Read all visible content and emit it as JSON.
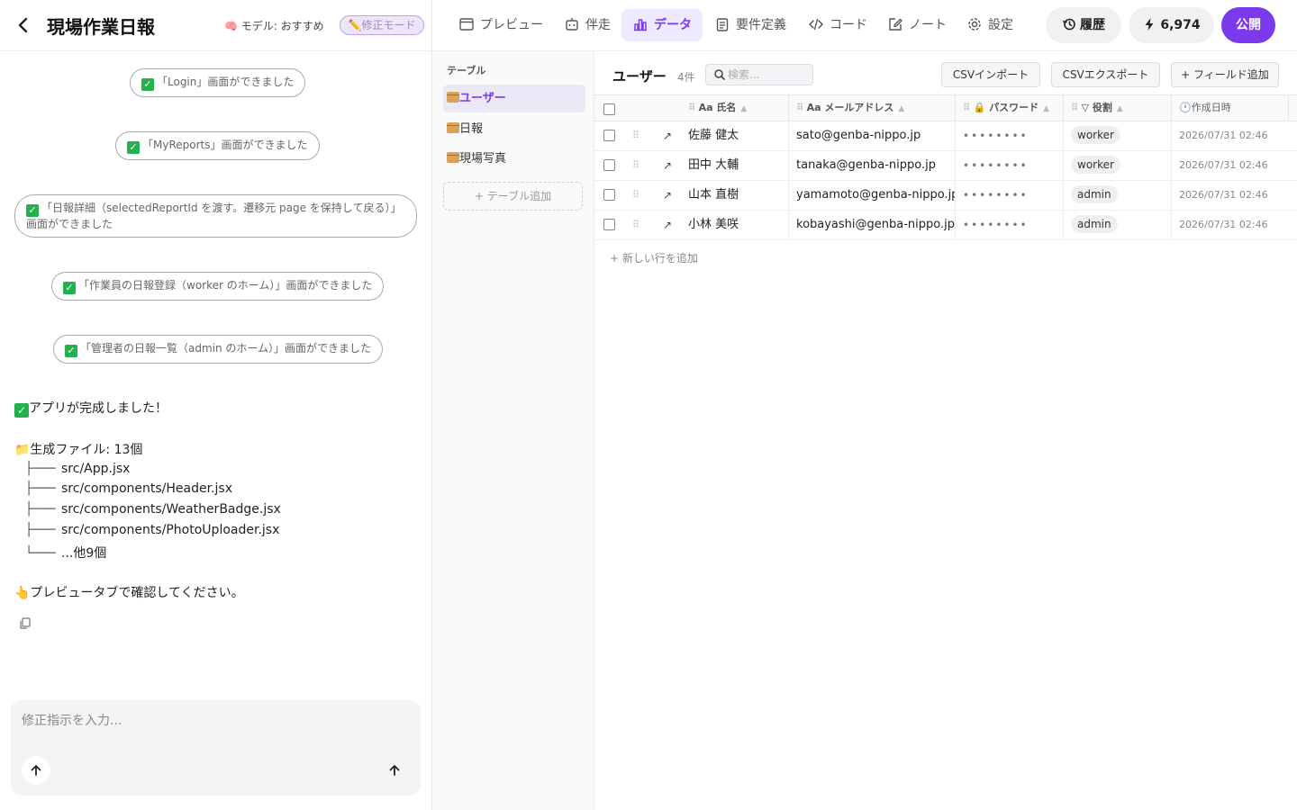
{
  "left_panel": {
    "title": "現場作業日報",
    "model_label": "🧠 モデル: おすすめ",
    "mode_badge": "✏️修正モード",
    "events": [
      "「Login」画面ができました",
      "「MyReports」画面ができました",
      "「日報詳細（selectedReportId を渡す。遷移元 page を保持して戻る）」画面ができました",
      "「作業員の日報登録（worker のホーム）」画面ができました",
      "「管理者の日報一覧（admin のホーム）」画面ができました"
    ],
    "complete_message": "アプリが完成しました！",
    "files_label": "📁生成ファイル: 13個",
    "tree_branch": "├───",
    "tree_last": "└───",
    "files": [
      "src/App.jsx",
      "src/components/Header.jsx",
      "src/components/WeatherBadge.jsx",
      "src/components/PhotoUploader.jsx"
    ],
    "more_files": "...他9個",
    "preview_hint": "👆プレビュータブで確認してください。",
    "input_placeholder": "修正指示を入力..."
  },
  "nav": {
    "tabs": [
      "プレビュー",
      "伴走",
      "データ",
      "要件定義",
      "コード",
      "ノート",
      "設定"
    ],
    "active_tab": "データ",
    "history": "履歴",
    "credits": "6,974",
    "publish": "公開"
  },
  "sidebar": {
    "title": "テーブル",
    "tables": [
      "ユーザー",
      "日報",
      "現場写真"
    ],
    "active": "ユーザー",
    "add_table": "+ テーブル追加"
  },
  "table": {
    "title": "ユーザー",
    "count": "4件",
    "search_placeholder": "検索...",
    "csv_import": "CSVインポート",
    "csv_export": "CSVエクスポート",
    "add_field": "+ フィールド追加",
    "columns": [
      {
        "icon": "Aa",
        "label": "氏名"
      },
      {
        "icon": "Aa",
        "label": "メールアドレス"
      },
      {
        "icon": "🔒",
        "label": "パスワード"
      },
      {
        "icon": "▽",
        "label": "役割"
      },
      {
        "icon": "🕐",
        "label": "作成日時"
      }
    ],
    "rows": [
      {
        "name": "佐藤 健太",
        "email": "sato@genba-nippo.jp",
        "password": "••••••••",
        "role": "worker",
        "created": "2026/07/31 02:46"
      },
      {
        "name": "田中 大輔",
        "email": "tanaka@genba-nippo.jp",
        "password": "••••••••",
        "role": "worker",
        "created": "2026/07/31 02:46"
      },
      {
        "name": "山本 直樹",
        "email": "yamamoto@genba-nippo.jp",
        "password": "••••••••",
        "role": "admin",
        "created": "2026/07/31 02:46"
      },
      {
        "name": "小林 美咲",
        "email": "kobayashi@genba-nippo.jp",
        "password": "••••••••",
        "role": "admin",
        "created": "2026/07/31 02:46"
      }
    ],
    "add_row": "+ 新しい行を追加"
  },
  "colors": {
    "accent": "#7c3aed",
    "accent_bg": "#efeaff",
    "check": "#22b14c"
  }
}
